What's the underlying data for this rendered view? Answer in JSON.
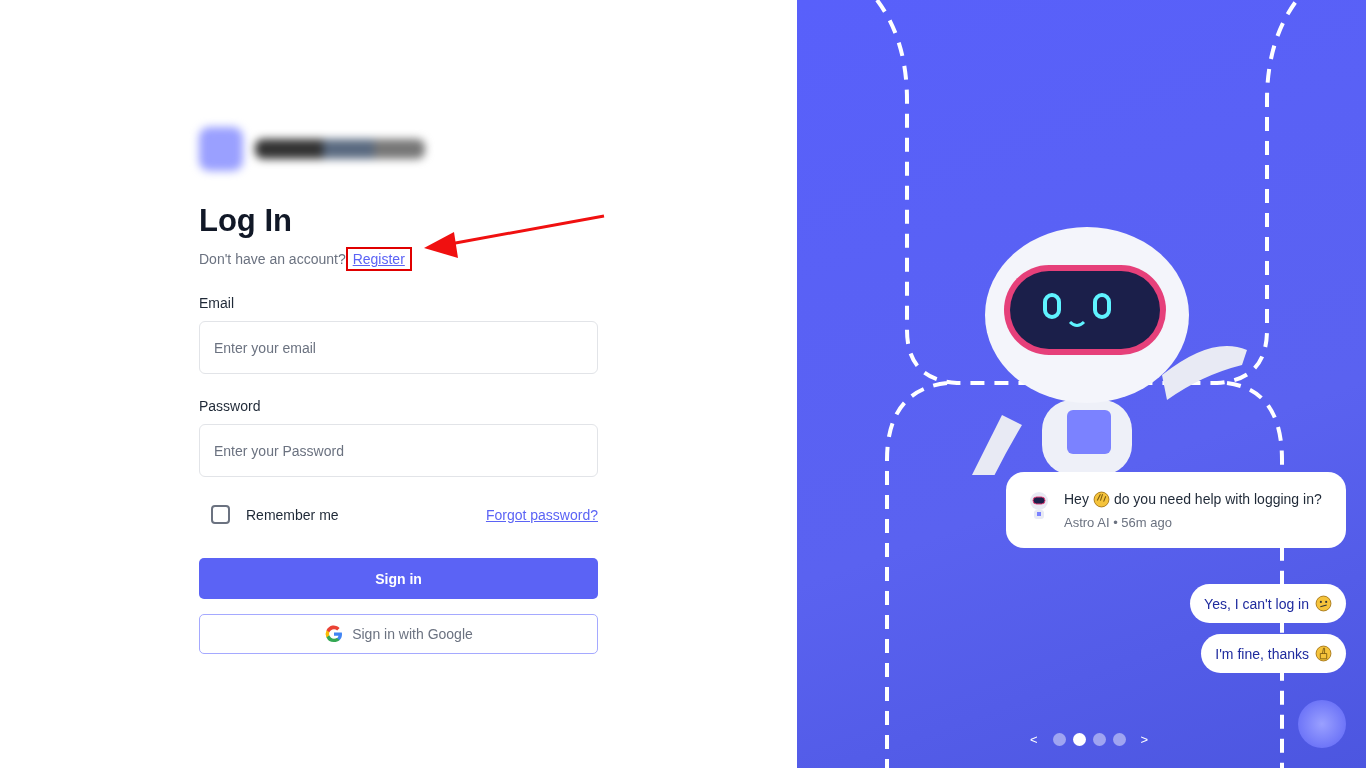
{
  "login": {
    "title": "Log In",
    "register_prompt": "Don't have an account?",
    "register_link": "Register",
    "email": {
      "label": "Email",
      "placeholder": "Enter your email"
    },
    "password": {
      "label": "Password",
      "placeholder": "Enter your Password"
    },
    "remember": {
      "label": "Remember me",
      "checked": false
    },
    "forgot_link": "Forgot password?",
    "sign_in_button": "Sign in",
    "google_button": "Sign in with Google"
  },
  "promo": {
    "chat": {
      "greeting": "Hey",
      "message": "do you need help with logging in?",
      "meta": "Astro AI • 56m ago"
    },
    "quick_replies": [
      "Yes, I can't log in",
      "I'm fine, thanks"
    ],
    "prev": "<",
    "next": ">",
    "dots": [
      {
        "selected": false
      },
      {
        "selected": true
      },
      {
        "selected": false
      },
      {
        "selected": false
      }
    ]
  }
}
